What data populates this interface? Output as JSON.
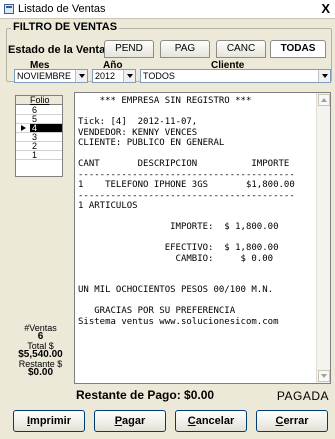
{
  "window": {
    "title": "Listado de Ventas",
    "close_label": "X"
  },
  "filter": {
    "legend": "FILTRO DE VENTAS",
    "estado_label": "Estado de la Venta:",
    "tabs": [
      {
        "label": "PEND",
        "active": false
      },
      {
        "label": "PAG",
        "active": false
      },
      {
        "label": "CANC",
        "active": false
      },
      {
        "label": "TODAS",
        "active": true
      }
    ],
    "mes_header": "Mes",
    "anio_header": "Año",
    "cliente_header": "Cliente",
    "mes_value": "NOVIEMBRE",
    "anio_value": "2012",
    "cliente_value": "TODOS"
  },
  "folio_list": {
    "header": "Folio",
    "rows": [
      {
        "num": "6",
        "selected": false
      },
      {
        "num": "5",
        "selected": false
      },
      {
        "num": "4",
        "selected": true
      },
      {
        "num": "3",
        "selected": false
      },
      {
        "num": "2",
        "selected": false
      },
      {
        "num": "1",
        "selected": false
      }
    ]
  },
  "stats": {
    "ventas_label": "#Ventas",
    "ventas_value": "6",
    "total_label": "Total $",
    "total_value": "$5,540.00",
    "restante_label": "Restante $",
    "restante_value": "$0.00"
  },
  "receipt": {
    "text": "    *** EMPRESA SIN REGISTRO ***\n\nTick: [4]  2012-11-07,\nVENDEDOR: KENNY VENCES\nCLIENTE: PUBLICO EN GENERAL\n\nCANT       DESCRIPCION          IMPORTE\n----------------------------------------\n1    TELEFONO IPHONE 3GS       $1,800.00\n----------------------------------------\n1 ARTICULOS\n\n                 IMPORTE:  $ 1,800.00\n\n                EFECTIVO:  $ 1,800.00\n                  CAMBIO:     $ 0.00\n\n\nUN MIL OCHOCIENTOS PESOS 00/100 M.N.\n\n   GRACIAS POR SU PREFERENCIA\nSistema ventus www.solucionesicom.com"
  },
  "footer": {
    "restante_pago": "Restante de Pago: $0.00",
    "status": "PAGADA"
  },
  "buttons": {
    "imprimir": {
      "first": "I",
      "rest": "mprimir"
    },
    "pagar": {
      "first": "P",
      "rest": "agar"
    },
    "cancelar": {
      "first": "C",
      "rest": "ancelar"
    },
    "cerrar": {
      "first": "C",
      "rest": "errar"
    }
  }
}
